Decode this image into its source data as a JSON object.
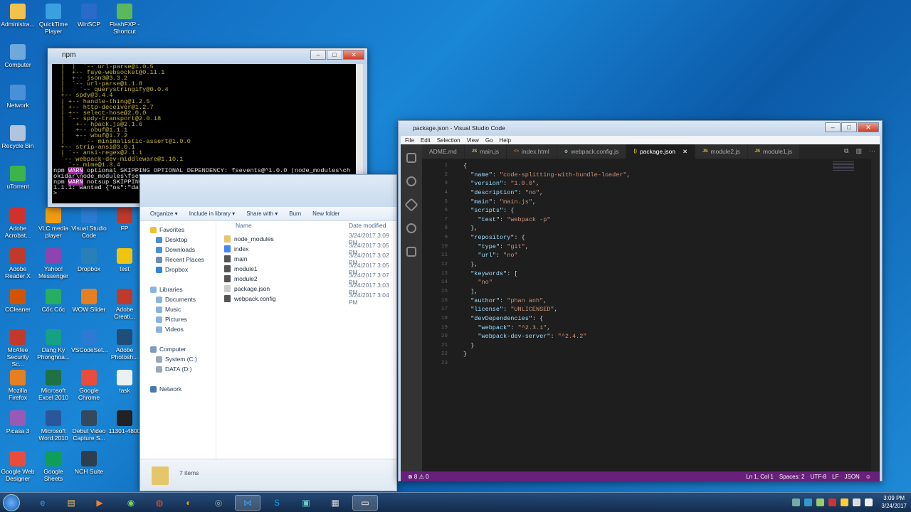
{
  "desktop": {
    "icons": [
      {
        "label": "Administra...",
        "x": "admin",
        "color": "#f2c14e"
      },
      {
        "label": "QuickTime Player",
        "color": "#3aa0e0"
      },
      {
        "label": "WinSCP",
        "color": "#2a6ac8"
      },
      {
        "label": "FlashFXP - Shortcut",
        "color": "#5cb85c"
      },
      {
        "label": "Computer",
        "color": "#6fa8dc"
      },
      {
        "label": "Network",
        "color": "#4a90d9"
      },
      {
        "label": "Recycle Bin",
        "color": "#b0c4de"
      },
      {
        "label": "uTorrent",
        "color": "#3cb44b"
      },
      {
        "label": "Adobe Acrobat...",
        "color": "#d0312d"
      },
      {
        "label": "VLC media player",
        "color": "#f39c12"
      },
      {
        "label": "Visual Studio Code",
        "color": "#2b7bd2"
      },
      {
        "label": "FP",
        "color": "#c0392b"
      },
      {
        "label": "Adobe Reader X",
        "color": "#c0392b"
      },
      {
        "label": "Yahoo! Messenger",
        "color": "#8e44ad"
      },
      {
        "label": "Dropbox",
        "color": "#2980b9"
      },
      {
        "label": "test",
        "color": "#f1c40f"
      },
      {
        "label": "CCleaner",
        "color": "#d35400"
      },
      {
        "label": "Cốc Cốc",
        "color": "#27ae60"
      },
      {
        "label": "WOW Slider",
        "color": "#e67e22"
      },
      {
        "label": "Adobe Creati...",
        "color": "#c0392b"
      },
      {
        "label": "McAfee Security Sc...",
        "color": "#c0392b"
      },
      {
        "label": "Dang Ky Phonghoa...",
        "color": "#16a085"
      },
      {
        "label": "VSCodeSet...",
        "color": "#2b7bd2"
      },
      {
        "label": "Adobe Photosh...",
        "color": "#1f4e79"
      },
      {
        "label": "Mozilla Firefox",
        "color": "#e67e22"
      },
      {
        "label": "Microsoft Excel 2010",
        "color": "#1e7145"
      },
      {
        "label": "Google Chrome",
        "color": "#e74c3c"
      },
      {
        "label": "task",
        "color": "#ecf0f1"
      },
      {
        "label": "Picasa 3",
        "color": "#9b59b6"
      },
      {
        "label": "Microsoft Word 2010",
        "color": "#2b579a"
      },
      {
        "label": "Debut Video Capture S...",
        "color": "#34495e"
      },
      {
        "label": "11301-4800",
        "color": "#222222"
      },
      {
        "label": "Google Web Designer",
        "color": "#e74c3c"
      },
      {
        "label": "Google Sheets",
        "color": "#0f9d58"
      },
      {
        "label": "NCH Suite",
        "color": "#2c3e50"
      }
    ]
  },
  "npm_window": {
    "title": "npm",
    "lines": [
      {
        "t": "  |  |  `-- url-parse@1.0.5",
        "c": "y"
      },
      {
        "t": "  |  +-- faye-websocket@0.11.1",
        "c": "y"
      },
      {
        "t": "  |  +-- json3@3.3.2",
        "c": "y"
      },
      {
        "t": "  |  `-- url-parse@1.1.8",
        "c": "y"
      },
      {
        "t": "  |    `-- querystringify@0.0.4",
        "c": "y"
      },
      {
        "t": "  +-- spdy@3.4.4",
        "c": "y"
      },
      {
        "t": "  | +-- handle-thing@1.2.5",
        "c": "y"
      },
      {
        "t": "  | +-- http-deceiver@1.2.7",
        "c": "y"
      },
      {
        "t": "  | +-- select-hose@2.0.0",
        "c": "y"
      },
      {
        "t": "  | `-- spdy-transport@2.0.18",
        "c": "y"
      },
      {
        "t": "  |   +-- hpack.js@2.1.6",
        "c": "y"
      },
      {
        "t": "  |   +-- obuf@1.1.1",
        "c": "y"
      },
      {
        "t": "  |   +-- wbuf@1.7.2",
        "c": "y"
      },
      {
        "t": "  |     `-- minimalistic-assert@1.0.0",
        "c": "y"
      },
      {
        "t": "  +-- strip-ansi@3.0.1",
        "c": "y"
      },
      {
        "t": "  | `-- ansi-regex@2.1.1",
        "c": "y"
      },
      {
        "t": "  `-- webpack-dev-middleware@1.10.1",
        "c": "y"
      },
      {
        "t": "    `-- mime@1.3.4",
        "c": "y"
      },
      {
        "t": "",
        "c": "w"
      },
      {
        "t": "npm WARN optional SKIPPING OPTIONAL DEPENDENCY: fsevents@^1.0.0 (node_modules\\ch",
        "c": "w",
        "warn": "WARN"
      },
      {
        "t": "okidar\\node_modules\\fsevents):",
        "c": "w"
      },
      {
        "t": "npm WARN notsup SKIPPING OPTIONAL DEPENDENCY: Unsupported platform for fsevents@",
        "c": "w",
        "warn": "WARN"
      },
      {
        "t": "1.1.1: wanted {\"os\":\"darwin\",\"arch\":\"any\"} (current: {\"os\":\"win32\",\"arch\":\"x64\"})",
        "c": "w"
      },
      {
        "t": ">",
        "c": "w"
      }
    ]
  },
  "explorer": {
    "toolbar": [
      "Organize ▾",
      "Include in library ▾",
      "Share with ▾",
      "Burn",
      "New folder"
    ],
    "nav": [
      {
        "label": "Favorites",
        "color": "#f0c030",
        "indent": 0
      },
      {
        "label": "Desktop",
        "color": "#4a90d9",
        "indent": 1
      },
      {
        "label": "Downloads",
        "color": "#4a90d9",
        "indent": 1
      },
      {
        "label": "Recent Places",
        "color": "#6a8fb5",
        "indent": 1
      },
      {
        "label": "Dropbox",
        "color": "#2e86de",
        "indent": 1
      },
      {
        "label": "Libraries",
        "color": "#8ab4e0",
        "indent": 0
      },
      {
        "label": "Documents",
        "color": "#8ab4e0",
        "indent": 1
      },
      {
        "label": "Music",
        "color": "#8ab4e0",
        "indent": 1
      },
      {
        "label": "Pictures",
        "color": "#8ab4e0",
        "indent": 1
      },
      {
        "label": "Videos",
        "color": "#8ab4e0",
        "indent": 1
      },
      {
        "label": "Computer",
        "color": "#7d9cbf",
        "indent": 0
      },
      {
        "label": "System (C:)",
        "color": "#9aa9b8",
        "indent": 1
      },
      {
        "label": "DATA (D:)",
        "color": "#9aa9b8",
        "indent": 1
      },
      {
        "label": "Network",
        "color": "#4a78b0",
        "indent": 0
      }
    ],
    "columns": {
      "name": "Name",
      "date": "Date modified"
    },
    "files": [
      {
        "name": "node_modules",
        "date": "3/24/2017 3:09 PM",
        "color": "#e6c66b"
      },
      {
        "name": "index",
        "date": "3/24/2017 3:05 PM",
        "color": "#4285f4"
      },
      {
        "name": "main",
        "date": "3/24/2017 3:02 PM",
        "color": "#555555"
      },
      {
        "name": "module1",
        "date": "3/24/2017 3:05 PM",
        "color": "#555555"
      },
      {
        "name": "module2",
        "date": "3/24/2017 3:07 PM",
        "color": "#555555"
      },
      {
        "name": "package.json",
        "date": "3/24/2017 3:03 PM",
        "color": "#cccccc"
      },
      {
        "name": "webpack.config",
        "date": "3/24/2017 3:04 PM",
        "color": "#555555"
      }
    ],
    "status": "7 items"
  },
  "vscode": {
    "title": "package.json - Visual Studio Code",
    "menu": [
      "File",
      "Edit",
      "Selection",
      "View",
      "Go",
      "Help"
    ],
    "tabs": [
      {
        "label": "ADME.md",
        "badge": "",
        "active": false
      },
      {
        "label": "main.js",
        "badge": "JS",
        "active": false
      },
      {
        "label": "index.html",
        "badge": "<>",
        "active": false
      },
      {
        "label": "webpack.config.js",
        "badge": "⚙",
        "active": false
      },
      {
        "label": "package.json",
        "badge": "{}",
        "active": true
      },
      {
        "label": "module2.js",
        "badge": "JS",
        "active": false
      },
      {
        "label": "module1.js",
        "badge": "JS",
        "active": false
      }
    ],
    "code": [
      "{",
      "  \"name\": \"code-splitting-with-bundle-loader\",",
      "  \"version\": \"1.0.0\",",
      "  \"description\": \"no\",",
      "  \"main\": \"main.js\",",
      "  \"scripts\": {",
      "    \"test\": \"webpack -p\"",
      "  },",
      "  \"repository\": {",
      "    \"type\": \"git\",",
      "    \"url\": \"no\"",
      "  },",
      "  \"keywords\": [",
      "    \"no\"",
      "  ],",
      "  \"author\": \"phan anh\",",
      "  \"license\": \"UNLICENSED\",",
      "  \"devDependencies\": {",
      "    \"webpack\": \"^2.3.1\",",
      "    \"webpack-dev-server\": \"^2.4.2\"",
      "  }",
      "}",
      ""
    ],
    "status_left": "⊗ 8  ⚠ 0",
    "status_right": [
      "Ln 1, Col 1",
      "Spaces: 2",
      "UTF-8",
      "LF",
      "JSON",
      "☺"
    ],
    "accent": "#68217a"
  },
  "taskbar": {
    "time": "3:09 PM",
    "date": "3/24/2017"
  }
}
